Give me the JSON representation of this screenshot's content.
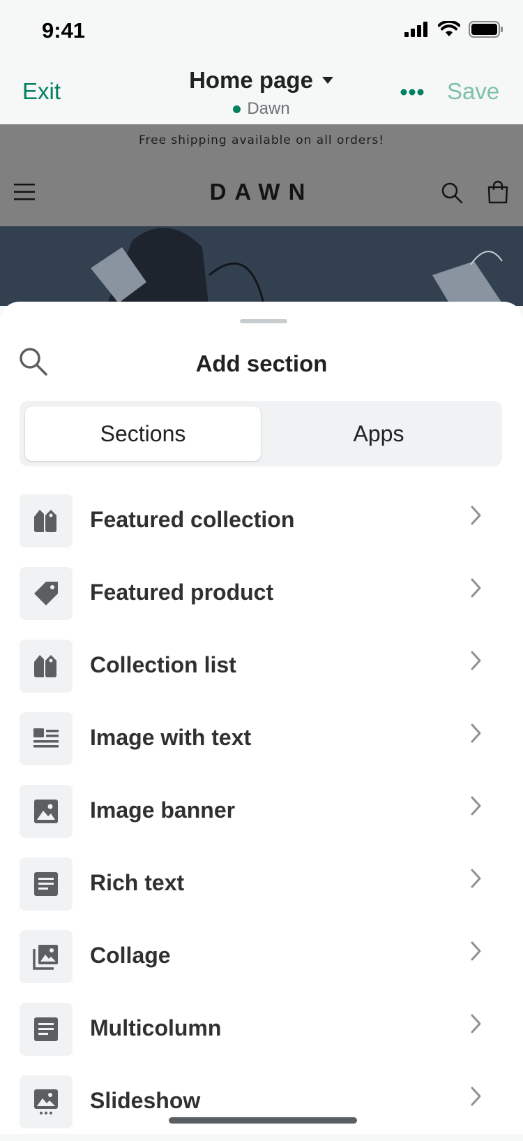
{
  "status_bar": {
    "time": "9:41"
  },
  "header": {
    "exit_label": "Exit",
    "page_title": "Home page",
    "theme_name": "Dawn",
    "save_label": "Save",
    "accent_color": "#008060"
  },
  "preview": {
    "announcement": "Free shipping available on all orders!",
    "store_logo": "DAWN"
  },
  "sheet": {
    "title": "Add section",
    "tabs": [
      {
        "label": "Sections",
        "selected": true
      },
      {
        "label": "Apps",
        "selected": false
      }
    ],
    "items": [
      {
        "label": "Featured collection",
        "icon": "collection-tags-icon"
      },
      {
        "label": "Featured product",
        "icon": "price-tag-icon"
      },
      {
        "label": "Collection list",
        "icon": "collection-tags-icon"
      },
      {
        "label": "Image with text",
        "icon": "image-with-text-icon"
      },
      {
        "label": "Image banner",
        "icon": "image-icon"
      },
      {
        "label": "Rich text",
        "icon": "text-block-icon"
      },
      {
        "label": "Collage",
        "icon": "collage-icon"
      },
      {
        "label": "Multicolumn",
        "icon": "text-block-icon"
      },
      {
        "label": "Slideshow",
        "icon": "slideshow-icon"
      }
    ]
  }
}
